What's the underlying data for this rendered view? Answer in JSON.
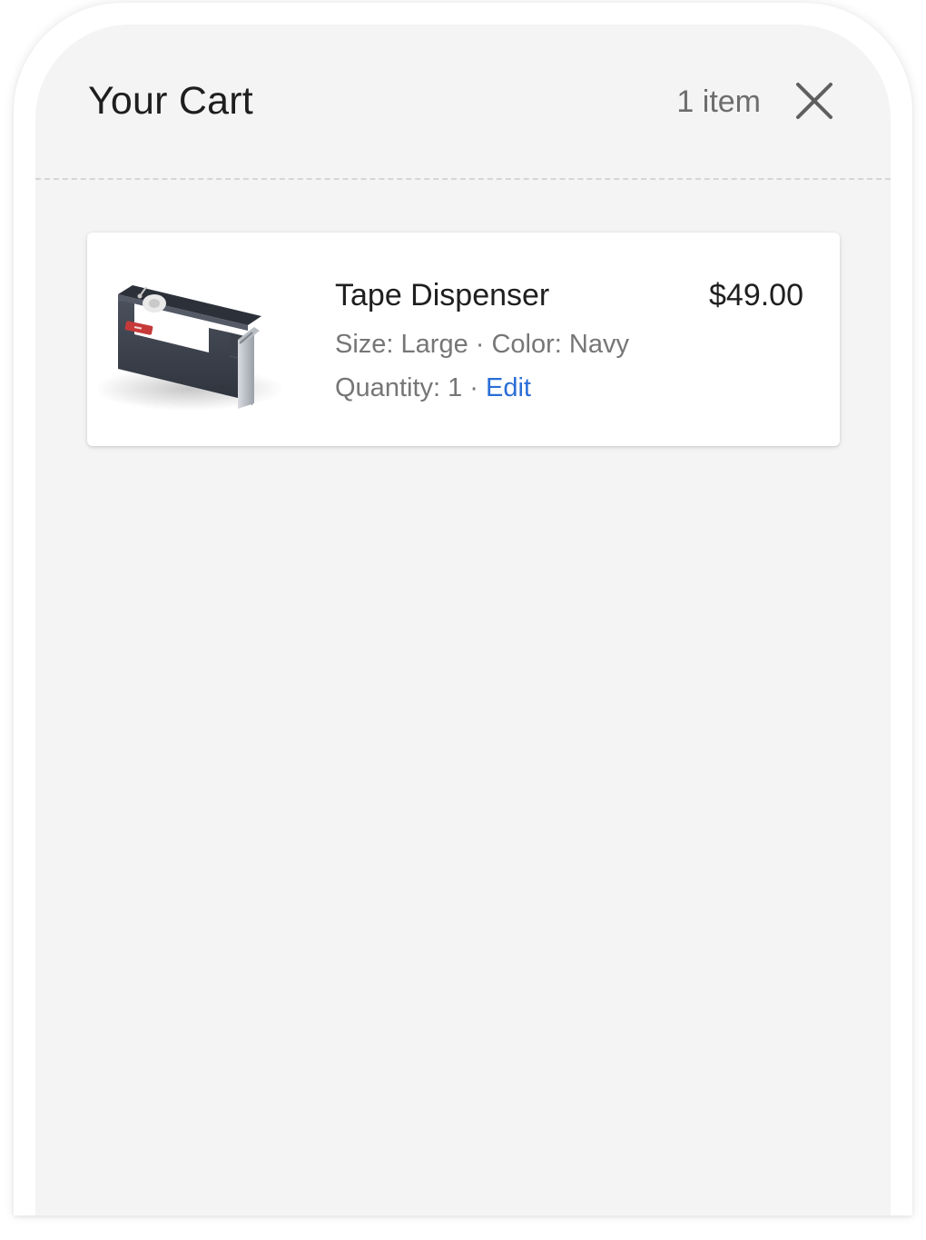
{
  "cart": {
    "title": "Your Cart",
    "item_count": "1 item",
    "close_icon": "close-icon"
  },
  "items": [
    {
      "name": "Tape Dispenser",
      "price": "$49.00",
      "options": "Size: Large · Color: Navy",
      "quantity_text": "Quantity: 1 · ",
      "edit_label": "Edit",
      "image": "tape-dispenser-image"
    }
  ],
  "colors": {
    "panel_background": "#f4f4f4",
    "link": "#2a6ed6",
    "product_navy": "#3a3f4a"
  }
}
